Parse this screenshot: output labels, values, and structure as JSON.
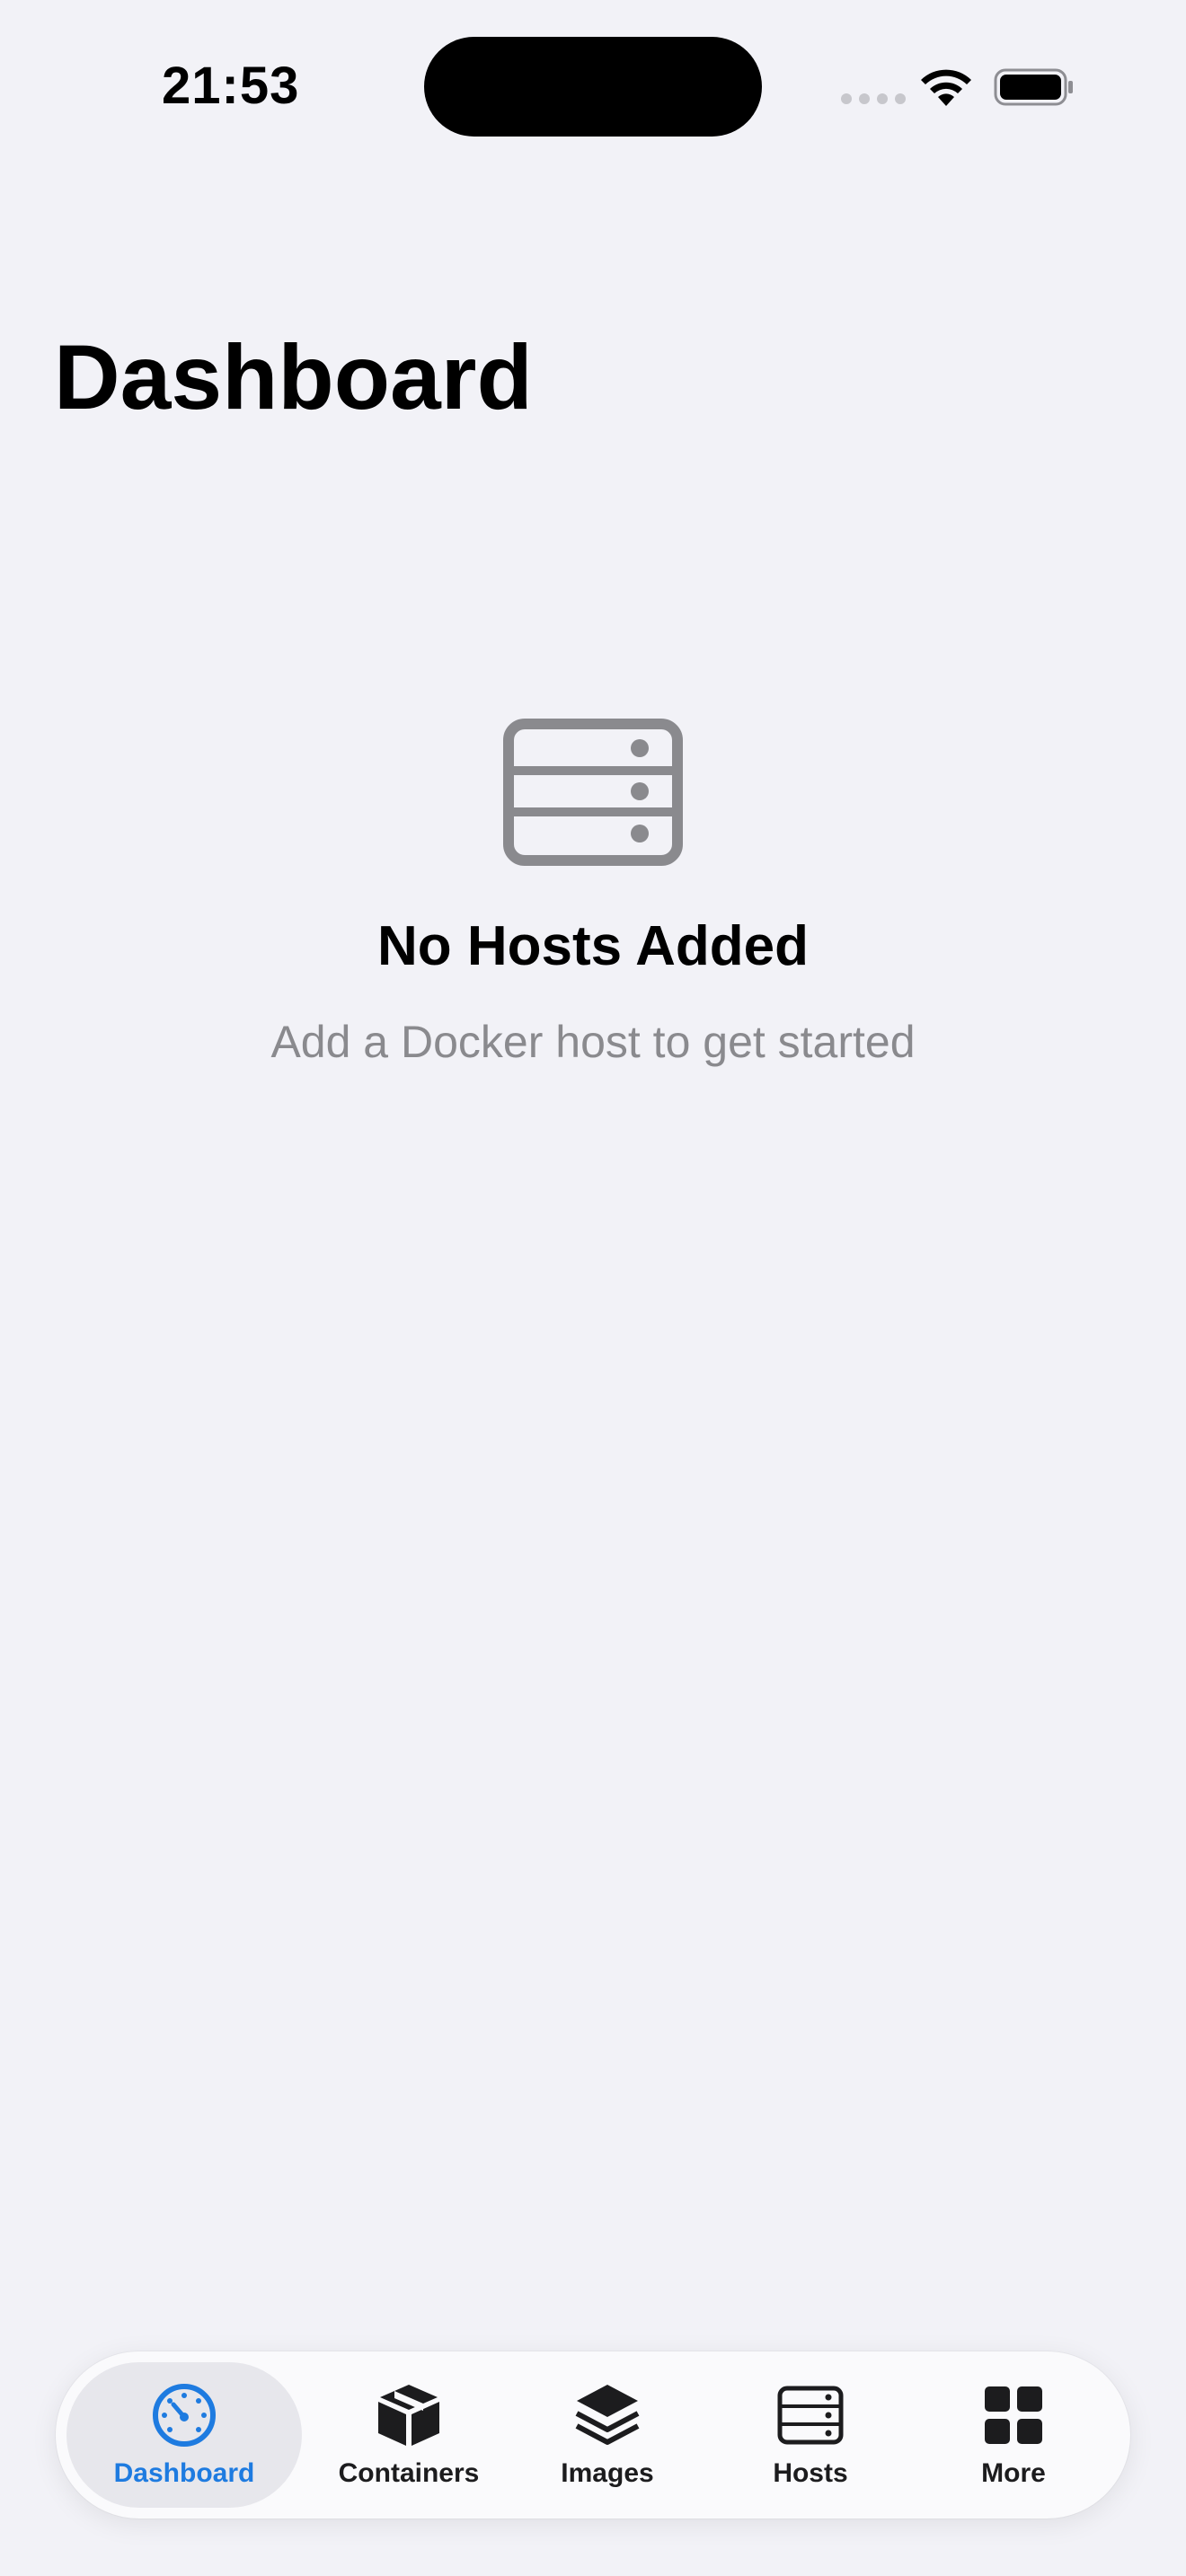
{
  "status_bar": {
    "time": "21:53"
  },
  "header": {
    "title": "Dashboard"
  },
  "empty_state": {
    "icon": "server-rack-icon",
    "title": "No Hosts Added",
    "subtitle": "Add a Docker host to get started"
  },
  "tab_bar": {
    "selected": "Dashboard",
    "accent_color": "#1e7be0",
    "tabs": [
      {
        "label": "Dashboard",
        "icon": "gauge-icon"
      },
      {
        "label": "Containers",
        "icon": "box-icon"
      },
      {
        "label": "Images",
        "icon": "layers-icon"
      },
      {
        "label": "Hosts",
        "icon": "server-icon"
      },
      {
        "label": "More",
        "icon": "grid-icon"
      }
    ]
  }
}
